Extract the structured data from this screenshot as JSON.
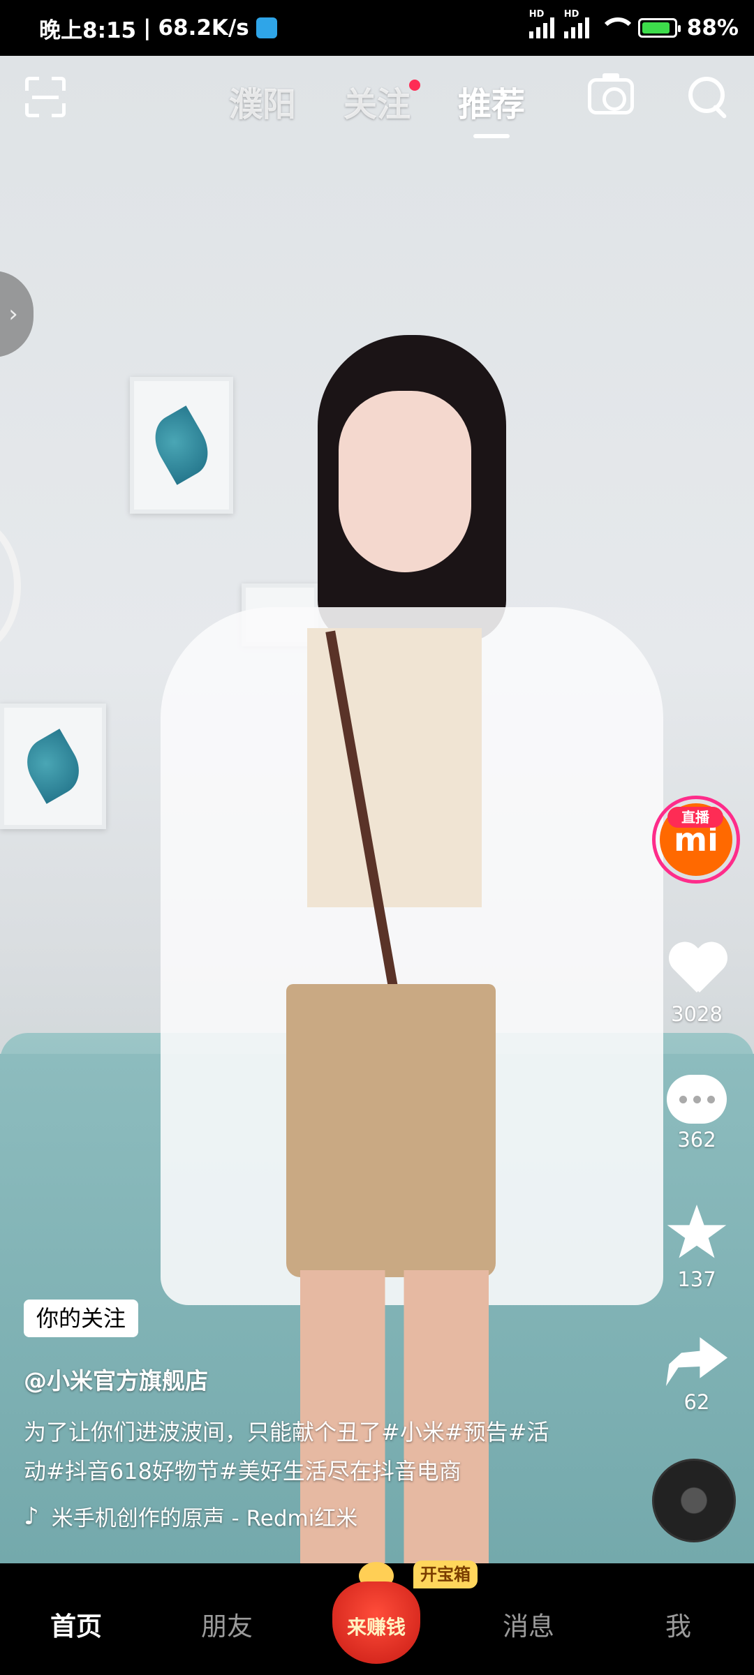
{
  "status_bar": {
    "time": "晚上8:15",
    "speed": "68.2K/s",
    "hd_label": "HD",
    "battery_percent": "88%",
    "battery_level": 0.88
  },
  "top_nav": {
    "tabs": [
      {
        "label": "濮阳"
      },
      {
        "label": "关注",
        "has_dot": true
      },
      {
        "label": "推荐",
        "active": true
      }
    ]
  },
  "side_tab": {
    "glyph": "›"
  },
  "actions": {
    "live_badge": "直播",
    "live_avatar_text": "mi",
    "like_count": "3028",
    "comment_count": "362",
    "favorite_count": "137",
    "share_count": "62"
  },
  "caption": {
    "follow_tag": "你的关注",
    "author": "@小米官方旗舰店",
    "description": "为了让你们进波波间，只能献个丑了#小米#预告#活动#抖音618好物节#美好生活尽在抖音电商",
    "music": "米手机创作的原声 - Redmi红米"
  },
  "bottom_nav": {
    "home": "首页",
    "friends": "朋友",
    "center_label": "来赚钱",
    "center_badge": "开宝箱",
    "messages": "消息",
    "me": "我"
  },
  "colors": {
    "accent": "#fe2c55",
    "brand_orange": "#ff6900"
  }
}
